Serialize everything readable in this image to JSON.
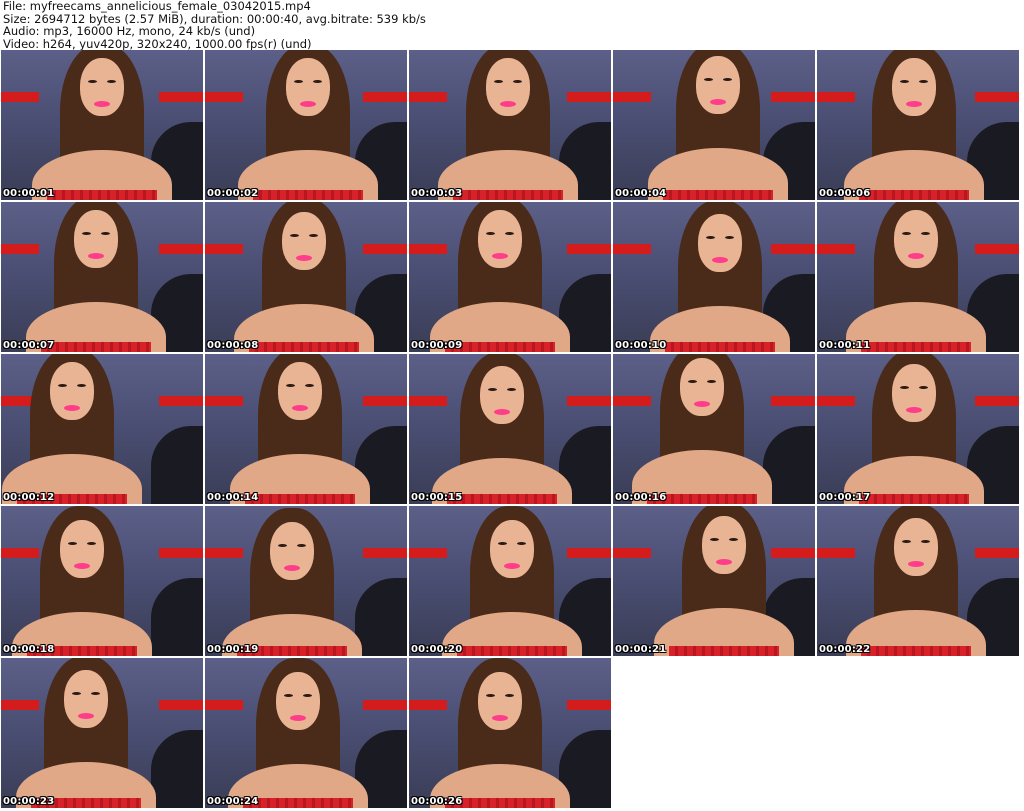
{
  "header": {
    "file_line": "File: myfreecams_annelicious_female_03042015.mp4",
    "size_line": "Size: 2694712 bytes (2.57 MiB), duration: 00:00:40, avg.bitrate: 539 kb/s",
    "audio_line": "Audio: mp3, 16000 Hz, mono, 24 kb/s (und)",
    "video_line": "Video: h264, yuv420p, 320x240, 1000.00 fps(r) (und)"
  },
  "thumbnails": [
    {
      "timestamp": "00:00:01"
    },
    {
      "timestamp": "00:00:02"
    },
    {
      "timestamp": "00:00:03"
    },
    {
      "timestamp": "00:00:04"
    },
    {
      "timestamp": "00:00:06"
    },
    {
      "timestamp": "00:00:07"
    },
    {
      "timestamp": "00:00:08"
    },
    {
      "timestamp": "00:00:09"
    },
    {
      "timestamp": "00:00:10"
    },
    {
      "timestamp": "00:00:11"
    },
    {
      "timestamp": "00:00:12"
    },
    {
      "timestamp": "00:00:14"
    },
    {
      "timestamp": "00:00:15"
    },
    {
      "timestamp": "00:00:16"
    },
    {
      "timestamp": "00:00:17"
    },
    {
      "timestamp": "00:00:18"
    },
    {
      "timestamp": "00:00:19"
    },
    {
      "timestamp": "00:00:20"
    },
    {
      "timestamp": "00:00:21"
    },
    {
      "timestamp": "00:00:22"
    },
    {
      "timestamp": "00:00:23"
    },
    {
      "timestamp": "00:00:24"
    },
    {
      "timestamp": "00:00:26"
    }
  ],
  "colors": {
    "background": "#ffffff",
    "timestamp_text": "#ffffff",
    "timestamp_outline": "#000000",
    "backdrop": "#4b4f74",
    "accent_red": "#d41c1c",
    "lip_pink": "#ff3d8a"
  }
}
